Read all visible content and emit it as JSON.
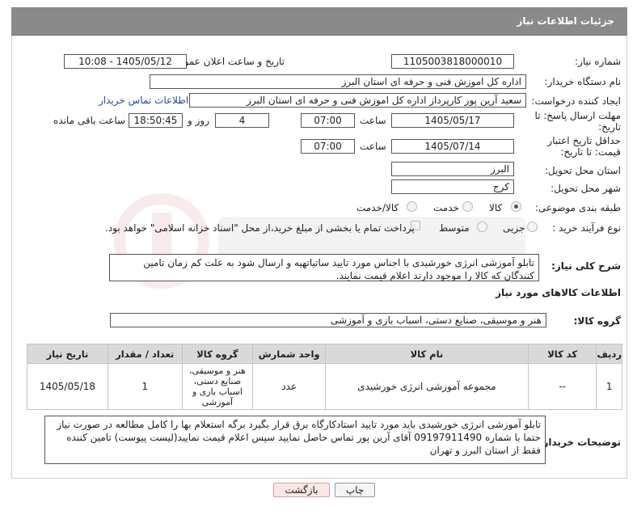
{
  "header": {
    "title": "جزئیات اطلاعات نیاز"
  },
  "fields": {
    "need_number_label": "شماره نیاز:",
    "need_number": "1105003818000010",
    "announce_label": "تاریخ و ساعت اعلان عمومی:",
    "announce_value": "1405/05/12 - 10:08",
    "buyer_org_label": "نام دستگاه خریدار:",
    "buyer_org": "اداره کل اموزش فنی و حرفه ای استان البرز",
    "creator_label": "ایجاد کننده درخواست:",
    "creator": "سعید آرین پور کارپرداز اداره کل اموزش فنی و حرفه ای استان البرز",
    "contact_link": "اطلاعات تماس خریدار",
    "reply_deadline_label": "مهلت ارسال پاسخ: تا تاریخ:",
    "reply_date": "1405/05/17",
    "time_label": "ساعت",
    "reply_time": "07:00",
    "days_value": "4",
    "days_label": "روز و",
    "remaining_time": "18:50:45",
    "remaining_label": "ساعت باقی مانده",
    "price_validity_label": "حداقل تاریخ اعتبار قیمت: تا تاریخ:",
    "validity_date": "1405/07/14",
    "validity_time": "07:00",
    "province_label": "استان محل تحویل:",
    "province": "البرز",
    "city_label": "شهر محل تحویل:",
    "city": "کرج",
    "category_label": "طبقه بندی موضوعی:",
    "category_options": [
      "کالا",
      "خدمت",
      "کالا/خدمت"
    ],
    "process_label": "نوع فرآیند خرید :",
    "process_options": [
      "جزیی",
      "متوسط"
    ],
    "payment_note": "پرداخت تمام یا بخشی از مبلغ خرید،از محل \"اسناد خزانه اسلامی\" خواهد بود."
  },
  "description": {
    "label": "شرح کلی نیاز:",
    "text": "تابلو آموزشی انرژی خورشیدی با اجناس مورد تایید ساتیاتهیه و ارسال شود به علت کم زمان تامین کنندگان که کالا را موجود دارند اعلام قیمت نمایند."
  },
  "goods": {
    "section_title": "اطلاعات کالاهای مورد نیاز",
    "group_label": "گروه کالا:",
    "group_value": "هنر و موسیقی، صنایع دستی، اسباب بازی و آموزشی",
    "columns": [
      "ردیف",
      "کد کالا",
      "نام کالا",
      "واحد شمارش",
      "گروه کالا",
      "تعداد / مقدار",
      "تاریخ نیاز"
    ],
    "rows": [
      {
        "row": "1",
        "code": "--",
        "name": "مجموعه آموزشی انرژی خورشیدی",
        "unit": "عدد",
        "group": "هنر و موسیقی، صنایع دستی، اسباب بازی و آموزشی",
        "qty": "1",
        "date": "1405/05/18"
      }
    ]
  },
  "buyer_notes": {
    "label": "توضیحات خریدار:",
    "text": "تابلو آموزشی انرژی خورشیدی باید مورد تایید استادکارگاه برق قرار بگیرد برگه استعلام بها را کامل مطالعه در صورت نیاز حتما با شماره 09197911490 آقای آرین پور تماس حاصل نمایید  سپس اعلام قیمت نمایید(لیست پیوست) تامین کننده فقط از استان البرز و تهران"
  },
  "buttons": {
    "print": "چاپ",
    "back": "بازگشت"
  },
  "colors": {
    "header_bg": "#8a8a8a",
    "link": "#1a4fb0",
    "back_bg": "#fde6e6"
  }
}
